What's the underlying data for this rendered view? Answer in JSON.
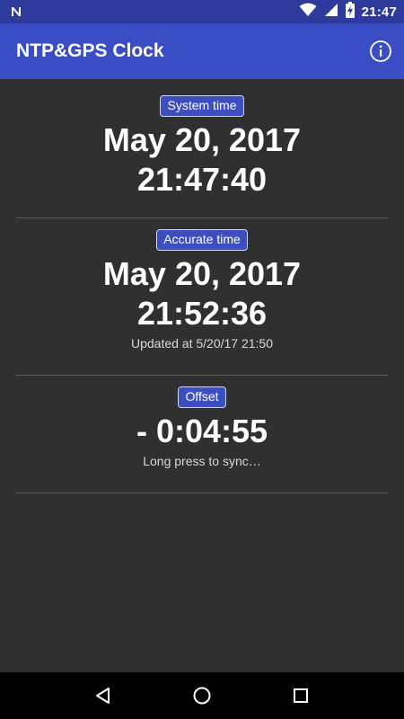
{
  "status_bar": {
    "time": "21:47",
    "icons": [
      "n-notification-icon",
      "wifi-icon",
      "cell-signal-icon",
      "battery-charging-icon"
    ]
  },
  "app_bar": {
    "title": "NTP&GPS Clock",
    "info_icon": "info-icon"
  },
  "system_time": {
    "label": "System time",
    "date": "May 20, 2017",
    "time": "21:47:40"
  },
  "accurate_time": {
    "label": "Accurate time",
    "date": "May 20, 2017",
    "time": "21:52:36",
    "updated": "Updated at 5/20/17 21:50"
  },
  "offset": {
    "label": "Offset",
    "value": "- 0:04:55",
    "hint": "Long press to sync…"
  },
  "nav_bar": {
    "icons": [
      "back-icon",
      "home-icon",
      "recents-icon"
    ]
  },
  "colors": {
    "status_bar": "#2e3b9c",
    "app_bar": "#3a4dc4",
    "background": "#303030",
    "badge": "#3d4fc0",
    "divider": "#5b5b5b"
  }
}
